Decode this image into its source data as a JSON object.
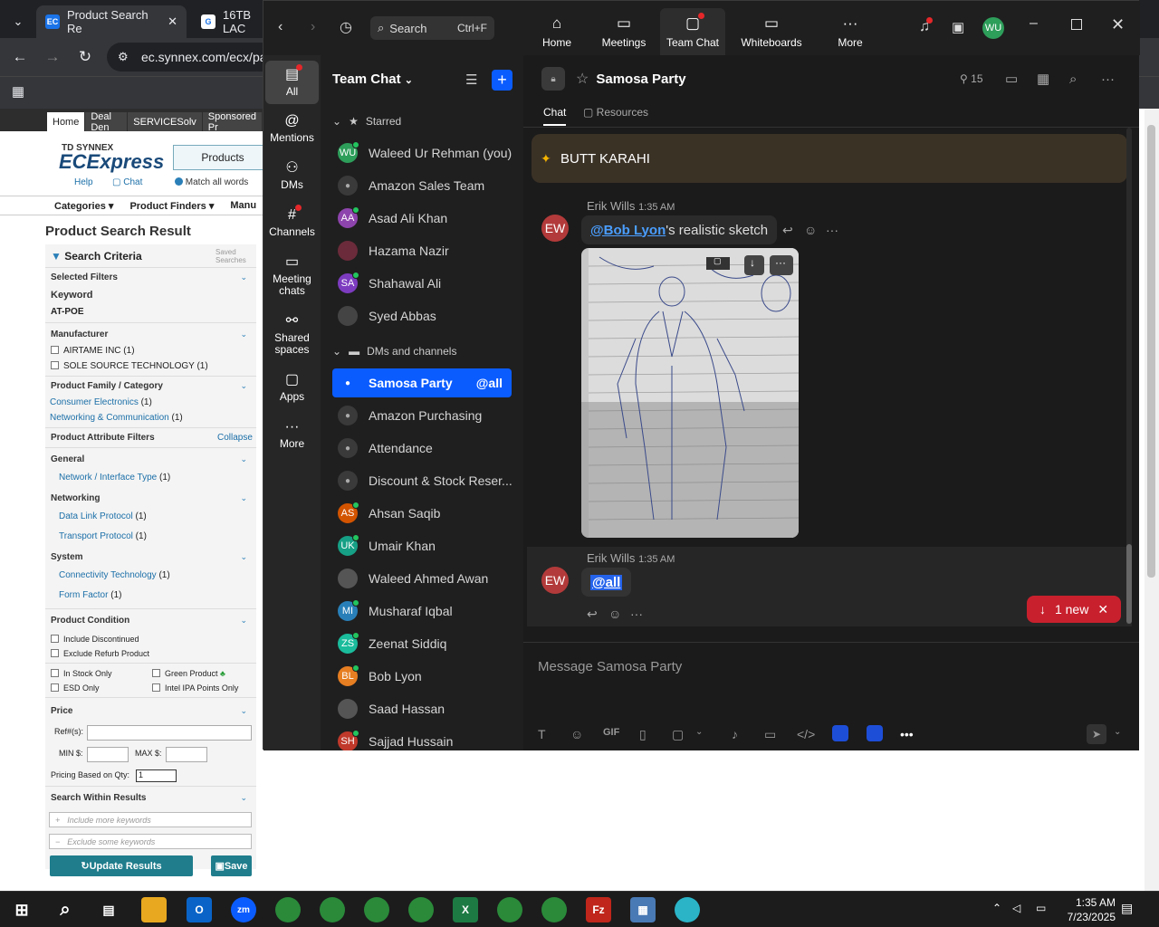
{
  "browser": {
    "tabs": [
      {
        "label": "Product Search Re",
        "favicon": "EC"
      },
      {
        "label": "16TB LAC",
        "favicon": "G"
      }
    ],
    "address": "ec.synnex.com/ecx/pa"
  },
  "site": {
    "nav": [
      "Home",
      "Deal Den",
      "SERVICESolv",
      "Sponsored Pr"
    ],
    "logo_small": "TD SYNNEX",
    "logo_big": "ECExpress",
    "products_btn": "Products",
    "help": "Help",
    "chat": "Chat",
    "match_all": "Match all words",
    "cats": [
      "Categories",
      "Product Finders",
      "Manu"
    ],
    "title": "Product Search Result",
    "search_criteria": "Search Criteria",
    "saved_searches": "Saved Searches",
    "selected_filters": "Selected Filters",
    "keyword_label": "Keyword",
    "keyword": "AT-POE",
    "manufacturer": "Manufacturer",
    "mfr1": "AIRTAME INC (1)",
    "mfr2": "SOLE SOURCE TECHNOLOGY (1)",
    "family": "Product Family / Category",
    "fam1": "Consumer Electronics",
    "fam1c": "(1)",
    "fam2": "Networking & Communication",
    "fam2c": "(1)",
    "attr": "Product Attribute Filters",
    "collapse": "Collapse",
    "general": "General",
    "gen1": "Network / Interface Type",
    "gen1c": "(1)",
    "networking": "Networking",
    "net1": "Data Link Protocol",
    "net1c": "(1)",
    "net2": "Transport Protocol",
    "net2c": "(1)",
    "system": "System",
    "sys1": "Connectivity Technology",
    "sys1c": "(1)",
    "sys2": "Form Factor",
    "sys2c": "(1)",
    "condition": "Product Condition",
    "cond1": "Include Discontinued",
    "cond2": "Exclude Refurb Product",
    "instock": "In Stock Only",
    "green": "Green Product",
    "esd": "ESD Only",
    "intel": "Intel IPA Points Only",
    "price": "Price",
    "ref": "Ref#(s):",
    "min": "MIN $:",
    "max": "MAX $:",
    "qty_label": "Pricing Based on Qty:",
    "qty": "1",
    "within": "Search Within Results",
    "include_ph": "Include more keywords",
    "exclude_ph": "Exclude some keywords",
    "update": "Update Results",
    "save": "Save"
  },
  "zoom": {
    "search": "Search",
    "shortcut": "Ctrl+F",
    "top": [
      "Home",
      "Meetings",
      "Team Chat",
      "Whiteboards",
      "More"
    ],
    "me": "WU",
    "side": [
      "All",
      "Mentions",
      "DMs",
      "Channels",
      "Meeting chats",
      "Shared spaces",
      "Apps",
      "More"
    ],
    "list_title": "Team Chat",
    "starred": "Starred",
    "starred_items": [
      {
        "name": "Waleed Ur Rehman (you)",
        "ini": "WU",
        "color": "#2e9e5b"
      },
      {
        "name": "Amazon Sales Team",
        "ini": "",
        "color": ""
      },
      {
        "name": "Asad Ali Khan",
        "ini": "AA",
        "color": "#8e44ad"
      },
      {
        "name": "Hazama Nazir",
        "ini": "",
        "color": "#6b2b3a"
      },
      {
        "name": "Shahawal Ali",
        "ini": "SA",
        "color": "#7d3cc0"
      },
      {
        "name": "Syed Abbas",
        "ini": "",
        "color": "#444"
      }
    ],
    "dms_label": "DMs and channels",
    "dm_items": [
      {
        "name": "Samosa Party",
        "ini": "",
        "color": "",
        "badge": "@all"
      },
      {
        "name": "Amazon Purchasing",
        "ini": "",
        "color": ""
      },
      {
        "name": "Attendance",
        "ini": "",
        "color": ""
      },
      {
        "name": "Discount & Stock Reser...",
        "ini": "",
        "color": ""
      },
      {
        "name": "Ahsan Saqib",
        "ini": "AS",
        "color": "#d35400"
      },
      {
        "name": "Umair Khan",
        "ini": "UK",
        "color": "#16a085"
      },
      {
        "name": "Waleed Ahmed Awan",
        "ini": "",
        "color": "#555"
      },
      {
        "name": "Musharaf Iqbal",
        "ini": "MI",
        "color": "#2980b9"
      },
      {
        "name": "Zeenat Siddiq",
        "ini": "ZS",
        "color": "#1abc9c"
      },
      {
        "name": "Bob Lyon",
        "ini": "BL",
        "color": "#e67e22"
      },
      {
        "name": "Saad Hassan",
        "ini": "",
        "color": "#555"
      },
      {
        "name": "Sajjad Hussain",
        "ini": "SH",
        "color": "#c0392b"
      }
    ],
    "channel": "Samosa Party",
    "members": "15",
    "tab_chat": "Chat",
    "tab_resources": "Resources",
    "pinned": "BUTT KARAHI",
    "msg1": {
      "author": "Erik Wills",
      "time": "1:35 AM",
      "mention": "@Bob Lyon",
      "text": "'s realistic sketch",
      "ini": "EW"
    },
    "msg2": {
      "author": "Erik Wills",
      "time": "1:35 AM",
      "mention": "@all",
      "ini": "EW"
    },
    "new_pill": "1 new",
    "compose_ph": "Message Samosa Party",
    "gif": "GIF"
  },
  "taskbar": {
    "time": "1:35 AM",
    "date": "7/23/2025"
  }
}
